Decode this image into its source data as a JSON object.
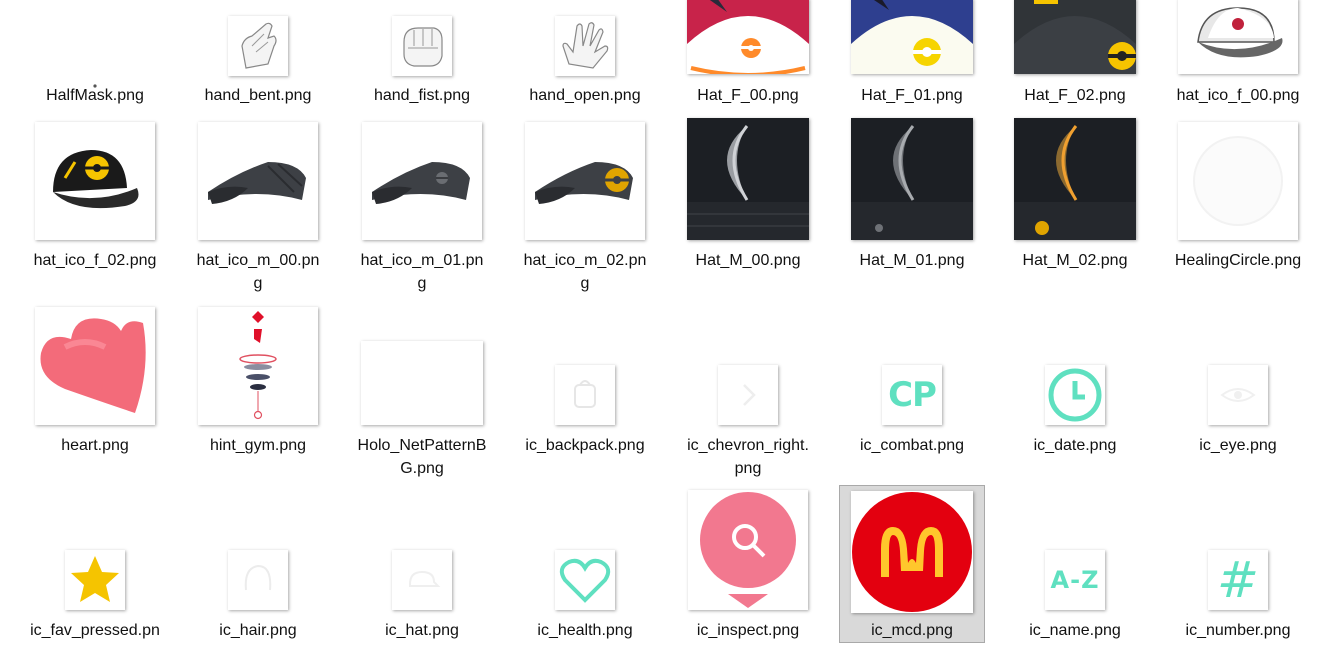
{
  "files": [
    {
      "name": "HalfMask.png"
    },
    {
      "name": "hand_bent.png"
    },
    {
      "name": "hand_fist.png"
    },
    {
      "name": "hand_open.png"
    },
    {
      "name": "Hat_F_00.png"
    },
    {
      "name": "Hat_F_01.png"
    },
    {
      "name": "Hat_F_02.png"
    },
    {
      "name": "hat_ico_f_00.png"
    },
    {
      "name": "hat_ico_f_02.png"
    },
    {
      "name": "hat_ico_m_00.pn",
      "name_line2": "g"
    },
    {
      "name": "hat_ico_m_01.pn",
      "name_line2": "g"
    },
    {
      "name": "hat_ico_m_02.pn",
      "name_line2": "g"
    },
    {
      "name": "Hat_M_00.png"
    },
    {
      "name": "Hat_M_01.png"
    },
    {
      "name": "Hat_M_02.png"
    },
    {
      "name": "HealingCircle.png"
    },
    {
      "name": "heart.png"
    },
    {
      "name": "hint_gym.png"
    },
    {
      "name": "Holo_NetPatternB",
      "name_line2": "G.png"
    },
    {
      "name": "ic_backpack.png"
    },
    {
      "name": "ic_chevron_right.",
      "name_line2": "png"
    },
    {
      "name": "ic_combat.png",
      "icon_text": "CP"
    },
    {
      "name": "ic_date.png"
    },
    {
      "name": "ic_eye.png"
    },
    {
      "name": "ic_fav_pressed.pn"
    },
    {
      "name": "ic_hair.png"
    },
    {
      "name": "ic_hat.png"
    },
    {
      "name": "ic_health.png"
    },
    {
      "name": "ic_inspect.png"
    },
    {
      "name": "ic_mcd.png",
      "selected": true
    },
    {
      "name": "ic_name.png",
      "icon_text": "A-Z"
    },
    {
      "name": "ic_number.png",
      "icon_text": "#"
    }
  ],
  "colors": {
    "selection": "#d9d9d9",
    "mint": "#5fe0c0",
    "pink": "#f2788f",
    "mcd_red": "#e3000f",
    "mcd_yellow": "#ffc72c",
    "star": "#f5c400"
  }
}
